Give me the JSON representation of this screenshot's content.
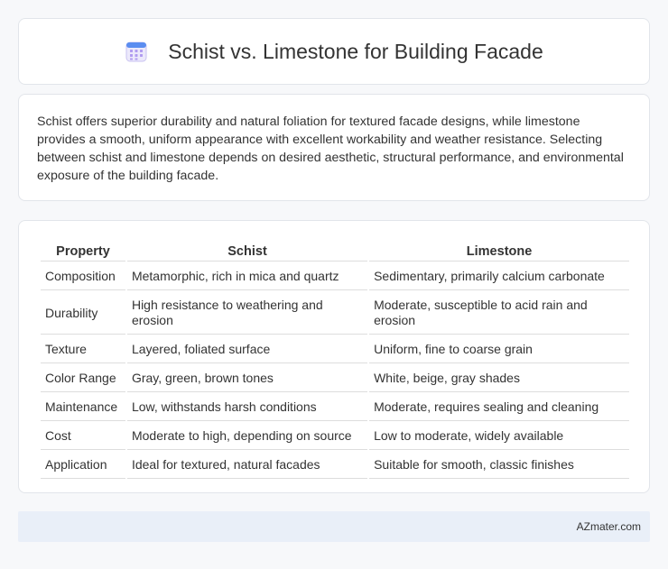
{
  "header": {
    "title": "Schist vs. Limestone for Building Facade",
    "icon": "calendar-icon"
  },
  "intro": {
    "text": "Schist offers superior durability and natural foliation for textured facade designs, while limestone provides a smooth, uniform appearance with excellent workability and weather resistance. Selecting between schist and limestone depends on desired aesthetic, structural performance, and environmental exposure of the building facade."
  },
  "table": {
    "headers": [
      "Property",
      "Schist",
      "Limestone"
    ],
    "rows": [
      [
        "Composition",
        "Metamorphic, rich in mica and quartz",
        "Sedimentary, primarily calcium carbonate"
      ],
      [
        "Durability",
        "High resistance to weathering and erosion",
        "Moderate, susceptible to acid rain and erosion"
      ],
      [
        "Texture",
        "Layered, foliated surface",
        "Uniform, fine to coarse grain"
      ],
      [
        "Color Range",
        "Gray, green, brown tones",
        "White, beige, gray shades"
      ],
      [
        "Maintenance",
        "Low, withstands harsh conditions",
        "Moderate, requires sealing and cleaning"
      ],
      [
        "Cost",
        "Moderate to high, depending on source",
        "Low to moderate, widely available"
      ],
      [
        "Application",
        "Ideal for textured, natural facades",
        "Suitable for smooth, classic finishes"
      ]
    ]
  },
  "footer": {
    "text": "AZmater.com"
  },
  "colors": {
    "icon_accent": "#8a7be0",
    "footer_bg": "#e9eff8"
  }
}
